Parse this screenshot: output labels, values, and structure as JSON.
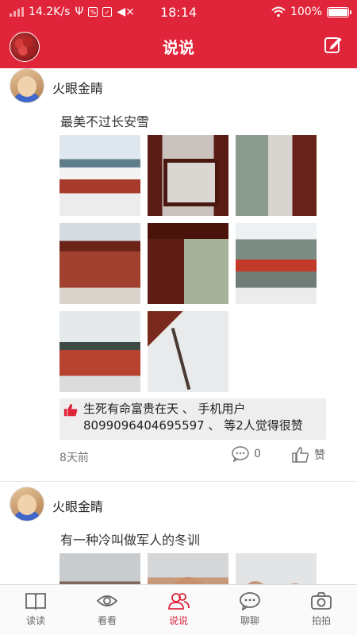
{
  "status": {
    "speed": "14.2K/s",
    "time": "18:14",
    "battery": "100%",
    "battery_level": 1.0
  },
  "nav": {
    "title": "说说",
    "avatar_icon": "avatar-berries",
    "edit_icon": "edit-icon"
  },
  "posts": [
    {
      "author": "火眼金睛",
      "text": "最美不过长安雪",
      "likes": "生死有命富贵在天 、 手机用户8099096404695597 、 等2人觉得很赞",
      "time": "8天前",
      "comments": "0",
      "like_label": "赞"
    },
    {
      "author": "火眼金睛",
      "text": "有一种冷叫做军人的冬训"
    }
  ],
  "tabs": [
    {
      "label": "读读",
      "icon": "book-icon"
    },
    {
      "label": "看看",
      "icon": "eye-icon"
    },
    {
      "label": "说说",
      "icon": "people-icon"
    },
    {
      "label": "聊聊",
      "icon": "chat-icon"
    },
    {
      "label": "拍拍",
      "icon": "camera-icon"
    }
  ],
  "colors": {
    "accent": "#e0243a",
    "tab_active": "#e0243a",
    "likes_bg": "#eeeeee"
  }
}
